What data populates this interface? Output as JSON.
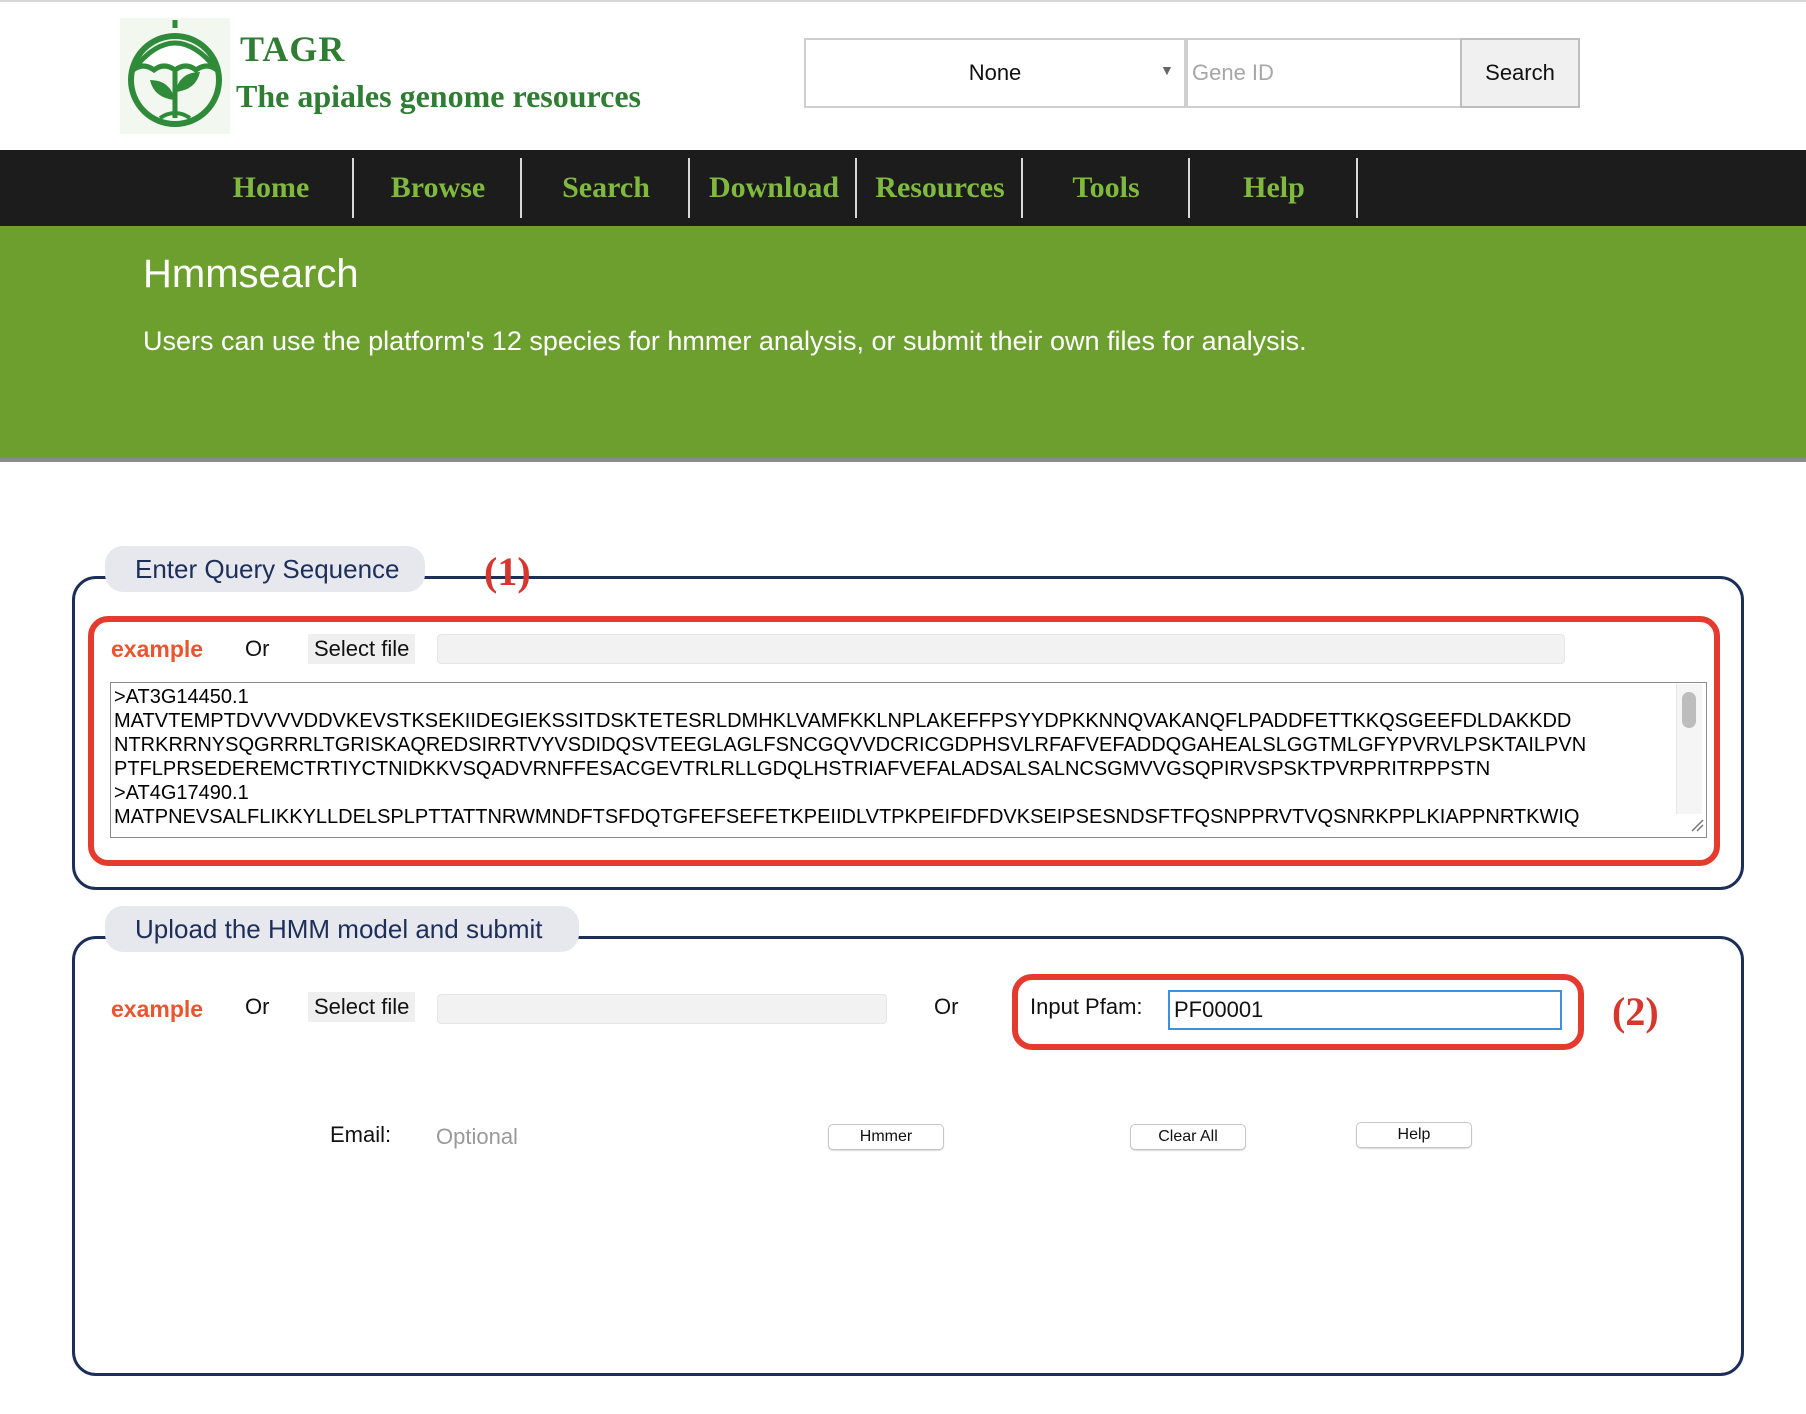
{
  "header": {
    "site_name": "TAGR",
    "site_subtitle": "The apiales genome resources",
    "species_select": {
      "selected": "None"
    },
    "gene_search": {
      "placeholder": "Gene ID",
      "value": ""
    },
    "search_label": "Search"
  },
  "nav": {
    "items": [
      {
        "label": "Home"
      },
      {
        "label": "Browse"
      },
      {
        "label": "Search"
      },
      {
        "label": "Download"
      },
      {
        "label": "Resources"
      },
      {
        "label": "Tools"
      },
      {
        "label": "Help"
      }
    ]
  },
  "banner": {
    "title": "Hmmsearch",
    "description": "Users can use the platform's 12 species for hmmer analysis, or submit their own files for analysis."
  },
  "query_section": {
    "legend": "Enter Query Sequence",
    "annotation": "(1)",
    "example_label": "example",
    "or_label": "Or",
    "select_file_label": "Select file",
    "sequence_lines": [
      ">AT3G14450.1",
      "MATVTEMPTDVVVVDDVKEVSTKSEKIIDEGIEKSSITDSKTETESRLDMHKLVAMFKKLNPLAKEFFPSYYDPKKNNQVAKANQFLPADDFETTKKQSGEEFDLDAKKDD",
      "NTRKRRNYSQGRRRLTGRISKAQREDSIRRTVYVSDIDQSVTEEGLAGLFSNCGQVVDCRICGDPHSVLRFAFVEFADDQGAHEALSLGGTMLGFYPVRVLPSKTAILPVN",
      "PTFLPRSEDEREMCTRTIYCTNIDKKVSQADVRNFFESACGEVTRLRLLGDQLHSTRIAFVEFALADSALSALNCSGMVVGSQPIRVSPSKTPVRPRITRPPSTN",
      ">AT4G17490.1",
      "MATPNEVSALFLIKKYLLDELSPLPTTATTNRWMNDFTSFDQTGFEFSEFETKPEIIDLVTPKPEIFDFDVKSEIPSESNDSFTFQSNPPRVTVQSNRKPPLKIAPPNRTKWIQ"
    ]
  },
  "hmm_section": {
    "legend": "Upload the HMM model and submit",
    "annotation": "(2)",
    "example_label": "example",
    "or_label": "Or",
    "select_file_label": "Select file",
    "or_label_2": "Or",
    "pfam_label": "Input Pfam:",
    "pfam_value": "PF00001",
    "email_label": "Email:",
    "email_placeholder": "Optional",
    "hmmer_label": "Hmmer",
    "clear_label": "Clear All",
    "help_label": "Help"
  },
  "colors": {
    "brand_green": "#2f7d32",
    "nav_text": "#7fb93d",
    "banner_green": "#6d9f2f",
    "annotation_red": "#e43b2e",
    "example_orange": "#e8552e",
    "fieldset_navy": "#1d2f59"
  },
  "icons": {
    "logo": "umbrella-plant-logo-icon",
    "select_arrow": "triangle-down-icon"
  }
}
